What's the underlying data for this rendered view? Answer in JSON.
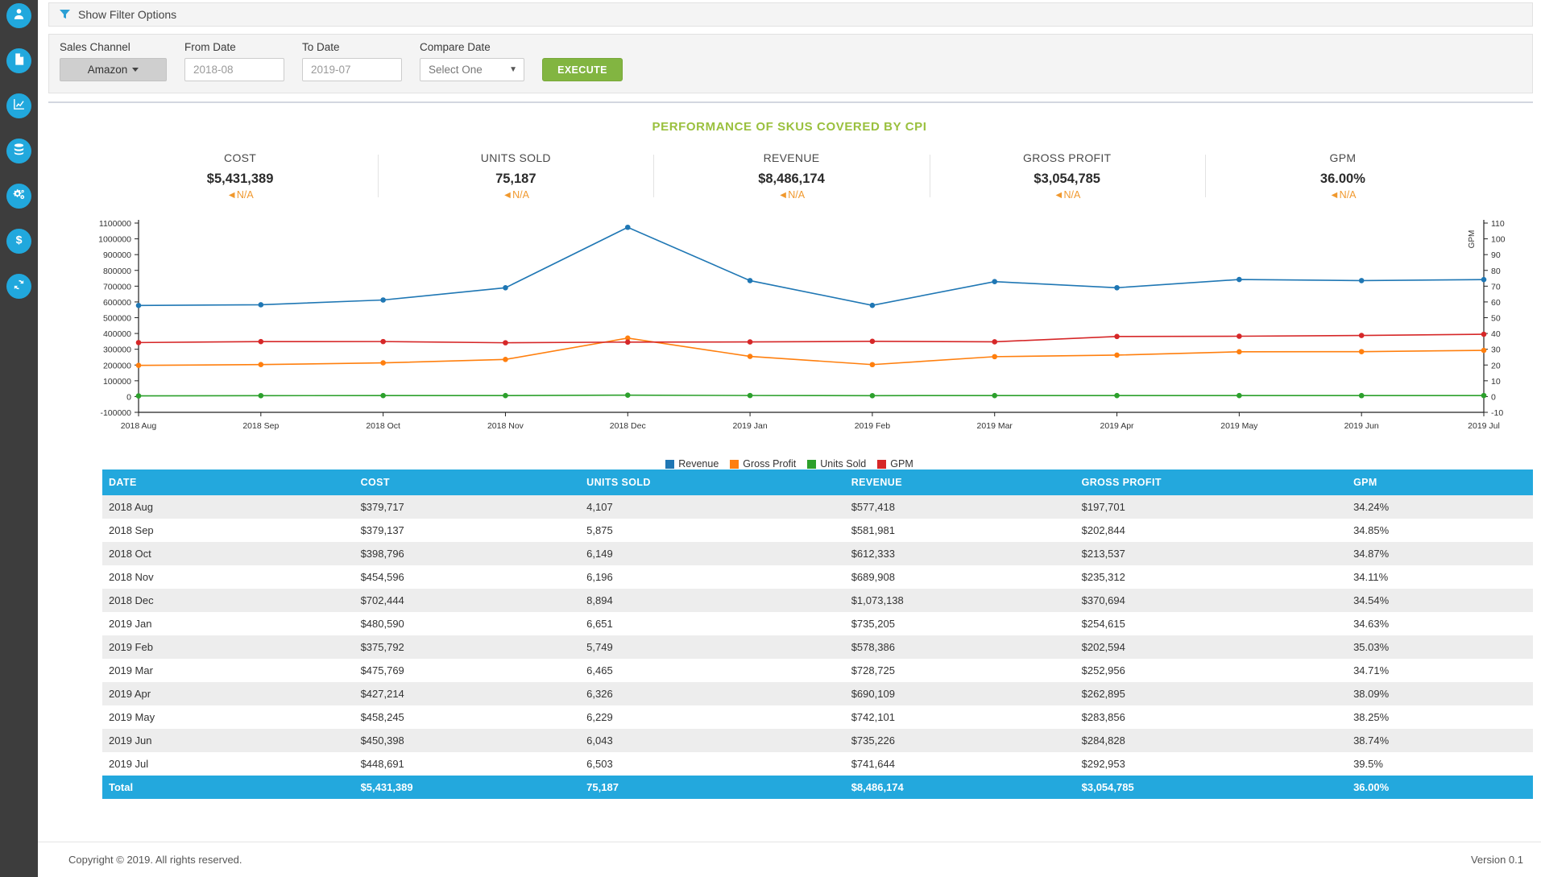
{
  "sidebar": {
    "items": [
      {
        "icon": "user-icon"
      },
      {
        "icon": "document-icon"
      },
      {
        "icon": "chart-line-icon"
      },
      {
        "icon": "database-icon"
      },
      {
        "icon": "gears-icon"
      },
      {
        "icon": "dollar-icon"
      },
      {
        "icon": "refresh-icon"
      }
    ]
  },
  "filter_toggle": {
    "label": "Show Filter Options",
    "icon": "funnel-icon"
  },
  "filters": {
    "sales_channel": {
      "label": "Sales Channel",
      "value": "Amazon"
    },
    "from_date": {
      "label": "From Date",
      "value": "2018-08",
      "placeholder": "2018-08"
    },
    "to_date": {
      "label": "To Date",
      "value": "2019-07",
      "placeholder": "2019-07"
    },
    "compare_date": {
      "label": "Compare Date",
      "value": "Select One"
    },
    "execute_button": "EXECUTE"
  },
  "panel": {
    "title": "PERFORMANCE OF SKUS COVERED BY CPI"
  },
  "kpis": [
    {
      "label": "COST",
      "value": "$5,431,389",
      "delta": "N/A"
    },
    {
      "label": "UNITS SOLD",
      "value": "75,187",
      "delta": "N/A"
    },
    {
      "label": "REVENUE",
      "value": "$8,486,174",
      "delta": "N/A"
    },
    {
      "label": "GROSS PROFIT",
      "value": "$3,054,785",
      "delta": "N/A"
    },
    {
      "label": "GPM",
      "value": "36.00%",
      "delta": "N/A"
    }
  ],
  "colors": {
    "revenue": "#1f77b4",
    "gross_profit": "#ff7f0e",
    "units_sold": "#2ca02c",
    "gpm": "#d62728",
    "accent_blue": "#23a8dd",
    "title_green": "#9ac03e",
    "execute_green": "#82b541",
    "delta_orange": "#f0982d"
  },
  "chart_data": {
    "type": "line",
    "title": "",
    "xlabel": "",
    "ylabel": "",
    "y2label": "GPM",
    "grid": false,
    "legend_position": "bottom",
    "x": [
      "2018 Aug",
      "2018 Sep",
      "2018 Oct",
      "2018 Nov",
      "2018 Dec",
      "2019 Jan",
      "2019 Feb",
      "2019 Mar",
      "2019 Apr",
      "2019 May",
      "2019 Jun",
      "2019 Jul"
    ],
    "ylim": [
      -100000,
      1100000
    ],
    "yticks": [
      -100000,
      0,
      100000,
      200000,
      300000,
      400000,
      500000,
      600000,
      700000,
      800000,
      900000,
      1000000,
      1100000
    ],
    "y2lim": [
      -10,
      110
    ],
    "y2ticks": [
      -10,
      0,
      10,
      20,
      30,
      40,
      50,
      60,
      70,
      80,
      90,
      100,
      110
    ],
    "series": [
      {
        "name": "Revenue",
        "axis": "left",
        "color": "#1f77b4",
        "values": [
          577418,
          581981,
          612333,
          689908,
          1073138,
          735205,
          578386,
          728725,
          690109,
          742101,
          735226,
          741644
        ]
      },
      {
        "name": "Gross Profit",
        "axis": "left",
        "color": "#ff7f0e",
        "values": [
          197701,
          202844,
          213537,
          235312,
          370694,
          254615,
          202594,
          252956,
          262895,
          283856,
          284828,
          292953
        ]
      },
      {
        "name": "Units Sold",
        "axis": "left",
        "color": "#2ca02c",
        "values": [
          4107,
          5875,
          6149,
          6196,
          8894,
          6651,
          5749,
          6465,
          6326,
          6229,
          6043,
          6503
        ]
      },
      {
        "name": "GPM",
        "axis": "right",
        "color": "#d62728",
        "values": [
          34.24,
          34.85,
          34.87,
          34.11,
          34.54,
          34.63,
          35.03,
          34.71,
          38.09,
          38.25,
          38.74,
          39.5
        ]
      }
    ]
  },
  "table": {
    "columns": [
      "DATE",
      "COST",
      "UNITS SOLD",
      "REVENUE",
      "GROSS PROFIT",
      "GPM"
    ],
    "rows": [
      [
        "2018 Aug",
        "$379,717",
        "4,107",
        "$577,418",
        "$197,701",
        "34.24%"
      ],
      [
        "2018 Sep",
        "$379,137",
        "5,875",
        "$581,981",
        "$202,844",
        "34.85%"
      ],
      [
        "2018 Oct",
        "$398,796",
        "6,149",
        "$612,333",
        "$213,537",
        "34.87%"
      ],
      [
        "2018 Nov",
        "$454,596",
        "6,196",
        "$689,908",
        "$235,312",
        "34.11%"
      ],
      [
        "2018 Dec",
        "$702,444",
        "8,894",
        "$1,073,138",
        "$370,694",
        "34.54%"
      ],
      [
        "2019 Jan",
        "$480,590",
        "6,651",
        "$735,205",
        "$254,615",
        "34.63%"
      ],
      [
        "2019 Feb",
        "$375,792",
        "5,749",
        "$578,386",
        "$202,594",
        "35.03%"
      ],
      [
        "2019 Mar",
        "$475,769",
        "6,465",
        "$728,725",
        "$252,956",
        "34.71%"
      ],
      [
        "2019 Apr",
        "$427,214",
        "6,326",
        "$690,109",
        "$262,895",
        "38.09%"
      ],
      [
        "2019 May",
        "$458,245",
        "6,229",
        "$742,101",
        "$283,856",
        "38.25%"
      ],
      [
        "2019 Jun",
        "$450,398",
        "6,043",
        "$735,226",
        "$284,828",
        "38.74%"
      ],
      [
        "2019 Jul",
        "$448,691",
        "6,503",
        "$741,644",
        "$292,953",
        "39.5%"
      ]
    ],
    "total_row": [
      "Total",
      "$5,431,389",
      "75,187",
      "$8,486,174",
      "$3,054,785",
      "36.00%"
    ]
  },
  "footer": {
    "copyright": "Copyright © 2019. All rights reserved.",
    "version": "Version 0.1"
  }
}
